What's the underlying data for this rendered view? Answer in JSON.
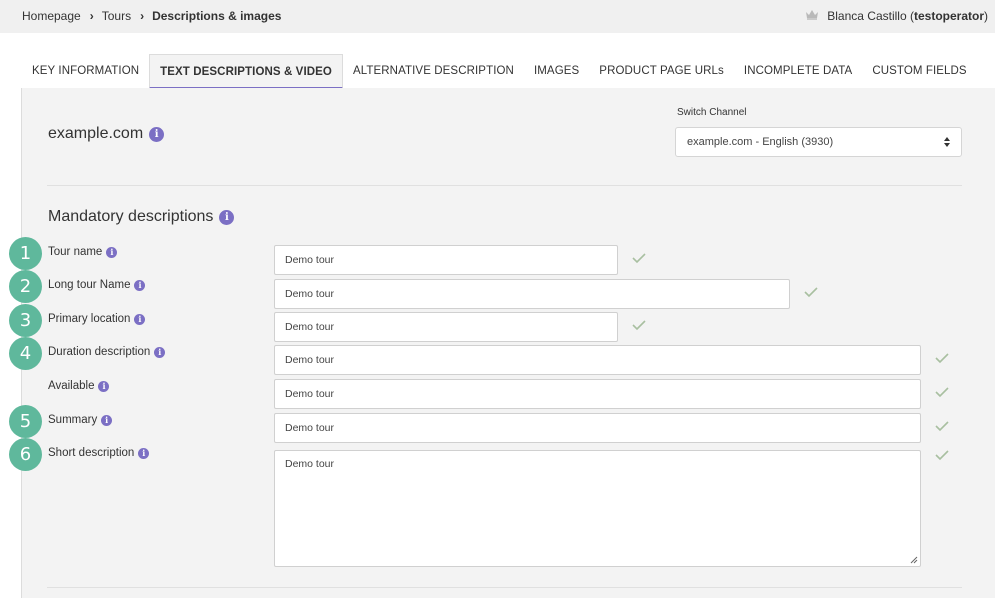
{
  "breadcrumb": {
    "home": "Homepage",
    "tours": "Tours",
    "current": "Descriptions & images"
  },
  "user": {
    "name": "Blanca Castillo",
    "username": "testoperator",
    "open_paren": "(",
    "close_paren": ")"
  },
  "tabs": [
    {
      "label": "KEY INFORMATION",
      "active": false
    },
    {
      "label": "TEXT DESCRIPTIONS & VIDEO",
      "active": true
    },
    {
      "label": "ALTERNATIVE DESCRIPTION",
      "active": false
    },
    {
      "label": "IMAGES",
      "active": false
    },
    {
      "label": "PRODUCT PAGE URLs",
      "active": false
    },
    {
      "label": "INCOMPLETE DATA",
      "active": false
    },
    {
      "label": "CUSTOM FIELDS",
      "active": false
    }
  ],
  "channel": {
    "site": "example.com",
    "switch_label": "Switch Channel",
    "selected": "example.com - English (3930)"
  },
  "section": {
    "title": "Mandatory descriptions"
  },
  "fields": [
    {
      "badge": "1",
      "label": "Tour name",
      "value": "Demo tour"
    },
    {
      "badge": "2",
      "label": "Long tour Name",
      "value": "Demo tour"
    },
    {
      "badge": "3",
      "label": "Primary location",
      "value": "Demo tour"
    },
    {
      "badge": "4",
      "label": "Duration description",
      "value": "Demo tour"
    },
    {
      "badge": "",
      "label": "Available",
      "value": "Demo tour"
    },
    {
      "badge": "5",
      "label": "Summary",
      "value": "Demo tour"
    },
    {
      "badge": "6",
      "label": "Short description",
      "value": "Demo tour"
    }
  ],
  "colors": {
    "accent": "#7b6fc4",
    "badge": "#5fb89c",
    "check": "#a8bfa0",
    "panel": "#f3f3f3",
    "topbar": "#f0f0f0"
  },
  "icons": {
    "info": "info-icon",
    "check": "checkmark-icon",
    "crown": "crown-icon",
    "chevron": "chevron-right-icon",
    "select_arrows": "sort-arrows-icon"
  }
}
